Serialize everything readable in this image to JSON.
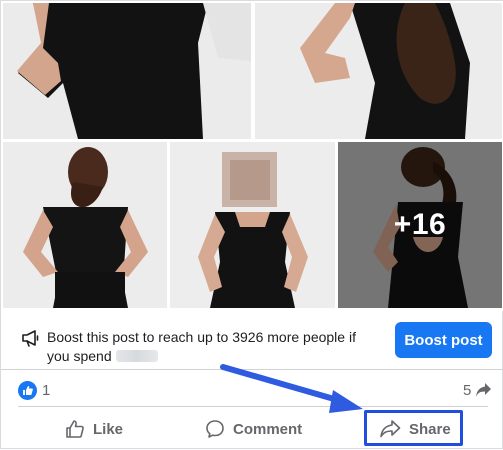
{
  "photos": {
    "more_count": "+16"
  },
  "boost": {
    "message": "Boost this post to reach up to 3926 more people if you spend",
    "button_label": "Boost post"
  },
  "reactions": {
    "like_count": "1",
    "share_count": "5"
  },
  "actions": {
    "like_label": "Like",
    "comment_label": "Comment",
    "share_label": "Share"
  },
  "icons": {
    "megaphone": "megaphone-icon",
    "like_badge": "thumbs-up-icon",
    "share_arrow": "share-arrow-icon",
    "like": "thumbs-up-outline-icon",
    "comment": "comment-bubble-icon",
    "share": "share-outline-icon"
  },
  "colors": {
    "brand_blue": "#1877f2",
    "annotation_blue": "#1f4fdc",
    "secondary_text": "#65676b"
  }
}
